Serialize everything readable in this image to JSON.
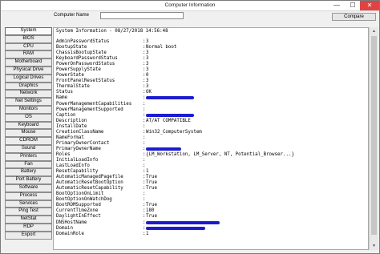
{
  "window": {
    "title": "Computer Information",
    "minimize": "—",
    "maximize": "☐",
    "close": "✕"
  },
  "toolbar": {
    "computer_name_label": "Computer Name",
    "computer_name_value": "",
    "compare_label": "Compare"
  },
  "sidebar": {
    "items": [
      {
        "label": "System",
        "active": true
      },
      {
        "label": "BIOS"
      },
      {
        "label": "CPU"
      },
      {
        "label": "RAM"
      },
      {
        "label": "Motherboard"
      },
      {
        "label": "Physical Drive"
      },
      {
        "label": "Logical Drives"
      },
      {
        "label": "Graphics"
      },
      {
        "label": "Network"
      },
      {
        "label": "Net Settings"
      },
      {
        "label": "Monitors"
      },
      {
        "label": "OS"
      },
      {
        "label": "Keyboard"
      },
      {
        "label": "Mouse"
      },
      {
        "label": "CDROM"
      },
      {
        "label": "Sound"
      },
      {
        "label": "Printers"
      },
      {
        "label": "Fan"
      },
      {
        "label": "Battery"
      },
      {
        "label": "Port Battery"
      },
      {
        "label": "Software"
      },
      {
        "label": "Process"
      },
      {
        "label": "Services"
      },
      {
        "label": "Ping Test"
      },
      {
        "label": "NetStat"
      },
      {
        "label": "RDP"
      },
      {
        "label": "Export"
      }
    ]
  },
  "info": {
    "header": "System Information - 08/27/2018 14:56:48",
    "rows": [
      {
        "key": "AdminPasswordStatus",
        "value": "3"
      },
      {
        "key": "BootupState",
        "value": "Normal boot"
      },
      {
        "key": "ChassisBootupState",
        "value": "3"
      },
      {
        "key": "KeyboardPasswordStatus",
        "value": "3"
      },
      {
        "key": "PowerOnPasswordStatus",
        "value": "3"
      },
      {
        "key": "PowerSupplyState",
        "value": "3"
      },
      {
        "key": "PowerState",
        "value": "0"
      },
      {
        "key": "FrontPanelResetStatus",
        "value": "3"
      },
      {
        "key": "ThermalState",
        "value": "3"
      },
      {
        "key": "Status",
        "value": "OK"
      },
      {
        "key": "Name",
        "value": "",
        "redacted": true
      },
      {
        "key": "PowerManagementCapabilities",
        "value": ""
      },
      {
        "key": "PowerManagementSupported",
        "value": ""
      },
      {
        "key": "Caption",
        "value": "",
        "redacted": true
      },
      {
        "key": "Description",
        "value": "AT/AT COMPATIBLE"
      },
      {
        "key": "InstallDate",
        "value": ""
      },
      {
        "key": "CreationClassName",
        "value": "Win32_ComputerSystem"
      },
      {
        "key": "NameFormat",
        "value": ""
      },
      {
        "key": "PrimaryOwnerContact",
        "value": ""
      },
      {
        "key": "PrimaryOwnerName",
        "value": "",
        "redacted": true
      },
      {
        "key": "Roles",
        "value": "{LM_Workstation, LM_Server, NT, Potential_Browser...}"
      },
      {
        "key": "InitialLoadInfo",
        "value": ""
      },
      {
        "key": "LastLoadInfo",
        "value": ""
      },
      {
        "key": "ResetCapability",
        "value": "1"
      },
      {
        "key": "AutomaticManagedPagefile",
        "value": "True"
      },
      {
        "key": "AutomaticResetBootOption",
        "value": "True"
      },
      {
        "key": "AutomaticResetCapability",
        "value": "True"
      },
      {
        "key": "BootOptionOnLimit",
        "value": ""
      },
      {
        "key": "BootOptionOnWatchDog",
        "value": ""
      },
      {
        "key": "BootROMSupported",
        "value": "True"
      },
      {
        "key": "CurrentTimeZone",
        "value": "180"
      },
      {
        "key": "DaylightInEffect",
        "value": "True"
      },
      {
        "key": "DNSHostName",
        "value": "",
        "redacted": true
      },
      {
        "key": "Domain",
        "value": "",
        "redacted": true
      },
      {
        "key": "DomainRole",
        "value": "1"
      }
    ]
  },
  "colors": {
    "redaction": "#1c1ccf",
    "close_button": "#e04343"
  }
}
